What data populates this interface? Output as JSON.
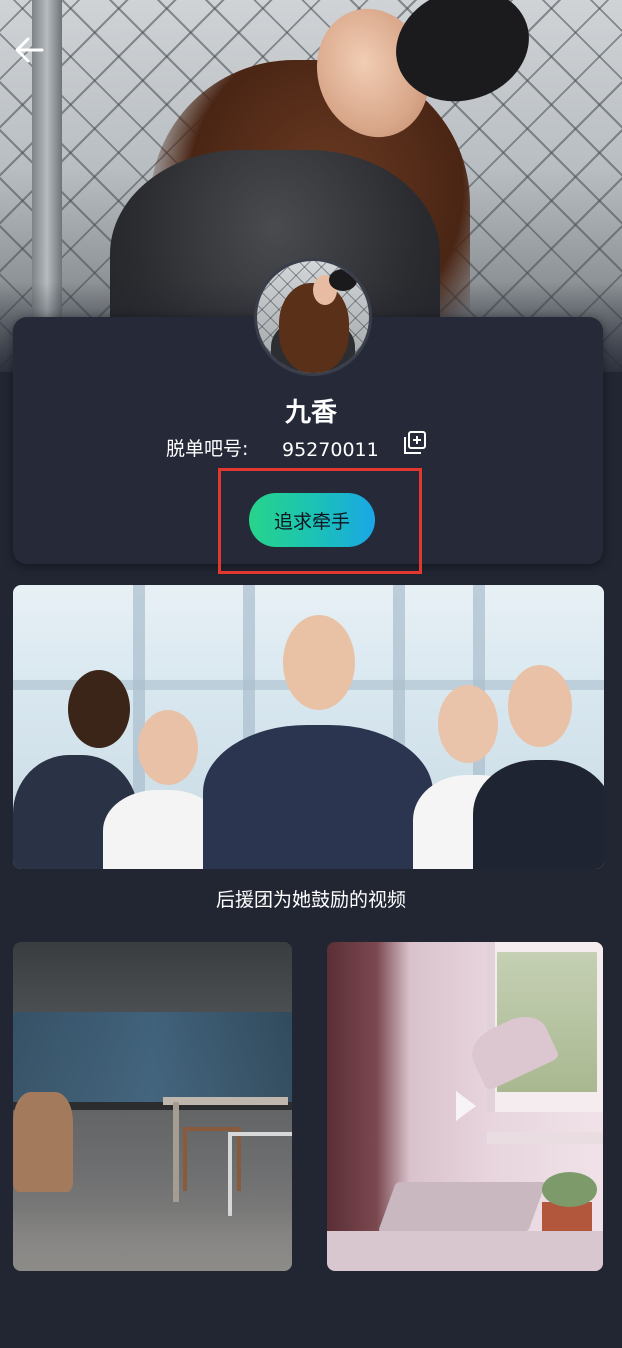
{
  "nav": {
    "back_icon": "arrow-left-icon"
  },
  "profile": {
    "name": "九香",
    "id_label": "脱单吧号:",
    "id_value": "95270011",
    "copy_icon": "copy-icon"
  },
  "action": {
    "pursue_label": "追求牵手"
  },
  "media": {
    "main_caption": "后援团为她鼓励的视频",
    "play_icon": "play-icon"
  },
  "colors": {
    "background": "#222633",
    "card": "#262a38",
    "button_start": "#27d48a",
    "button_end": "#19a7e6",
    "highlight": "#e2372f"
  }
}
